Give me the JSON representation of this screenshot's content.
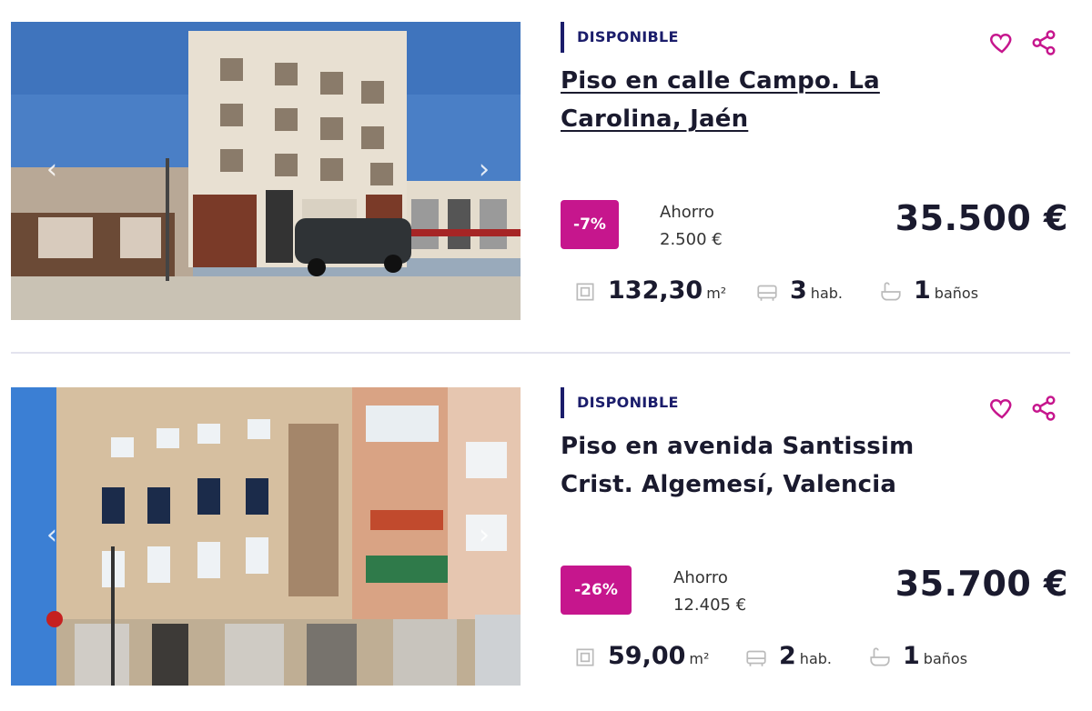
{
  "listings": [
    {
      "status": "DISPONIBLE",
      "title": "Piso en calle Campo. La Carolina, Jaén",
      "discount": "-7%",
      "saving_label": "Ahorro",
      "saving_value": "2.500 €",
      "price": "35.500 €",
      "area_value": "132,30",
      "area_unit": "m²",
      "rooms_value": "3",
      "rooms_unit": "hab.",
      "baths_value": "1",
      "baths_unit": "baños"
    },
    {
      "status": "DISPONIBLE",
      "title": "Piso en avenida Santissim Crist. Algemesí, Valencia",
      "discount": "-26%",
      "saving_label": "Ahorro",
      "saving_value": "12.405 €",
      "price": "35.700 €",
      "area_value": "59,00",
      "area_unit": "m²",
      "rooms_value": "2",
      "rooms_unit": "hab.",
      "baths_value": "1",
      "baths_unit": "baños"
    }
  ],
  "icons": {
    "prev": "chevron-left-icon",
    "next": "chevron-right-icon",
    "favorite": "heart-icon",
    "share": "share-icon",
    "area": "area-icon",
    "rooms": "bed-icon",
    "baths": "bathtub-icon"
  },
  "colors": {
    "accent": "#c6168d",
    "status": "#1b1d6b",
    "text": "#1a1a2e"
  }
}
